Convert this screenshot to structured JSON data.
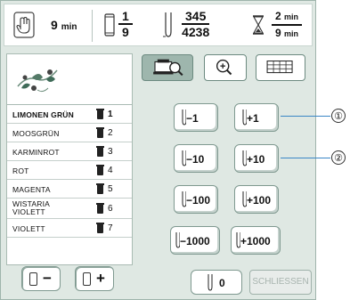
{
  "status_bar": {
    "sewing_time_value": "9",
    "sewing_time_unit": "min",
    "color_index": "1",
    "color_total": "9",
    "stitch_current": "345",
    "stitch_total": "4238",
    "time_remaining": "2",
    "time_remaining_unit": "min",
    "time_total": "9",
    "time_total_unit": "min"
  },
  "color_list": [
    {
      "name": "LIMONEN GRÜN",
      "number": "1",
      "selected": true
    },
    {
      "name": "MOOSGRÜN",
      "number": "2"
    },
    {
      "name": "KARMINROT",
      "number": "3"
    },
    {
      "name": "ROT",
      "number": "4"
    },
    {
      "name": "MAGENTA",
      "number": "5"
    },
    {
      "name_line1": "WISTARIA",
      "name_line2": "VIOLETT",
      "number": "6"
    },
    {
      "name": "VIOLETT",
      "number": "7"
    }
  ],
  "spool_buttons": {
    "minus": "−",
    "plus": "+"
  },
  "stitch_buttons": [
    {
      "label": "−1"
    },
    {
      "label": "+1"
    },
    {
      "label": "−10"
    },
    {
      "label": "+10"
    },
    {
      "label": "−100"
    },
    {
      "label": "+100"
    },
    {
      "label": "−1000"
    },
    {
      "label": "+1000"
    }
  ],
  "zero_button": "0",
  "close_button": "SCHLIESSEN",
  "callouts": {
    "one": "①",
    "two": "②"
  },
  "colors": {
    "screen_bg": "#dfe8e3",
    "accent_line": "#3a86c6",
    "active_tool": "#9eb6ad"
  }
}
